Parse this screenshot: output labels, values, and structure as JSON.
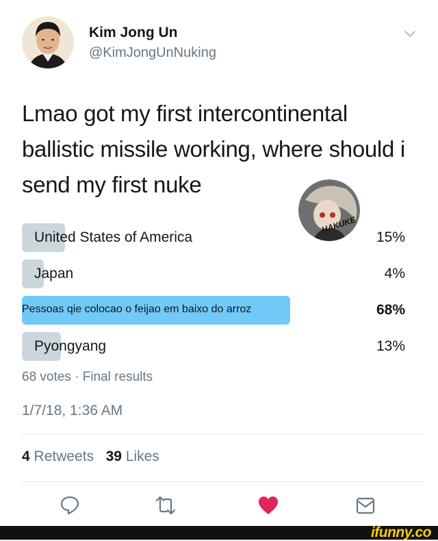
{
  "user": {
    "name": "Kim Jong Un",
    "handle": "@KimJongUnNuking"
  },
  "tweet": {
    "text": "Lmao got my first intercontinental ballistic missile working, where should i send my first nuke"
  },
  "poll": {
    "options": [
      {
        "label": "United States of America",
        "percent_label": "15%",
        "percent": 15
      },
      {
        "label": "Japan",
        "percent_label": "4%",
        "percent": 4
      },
      {
        "label": "Pessoas qie colocao o feijao em baixo do arroz",
        "percent_label": "68%",
        "percent": 68
      },
      {
        "label": "Pyongyang",
        "percent_label": "13%",
        "percent": 13
      }
    ],
    "summary": "68 votes · Final results"
  },
  "timestamp": "1/7/18, 1:36 AM",
  "stats": {
    "retweets_count": "4",
    "retweets_label": "Retweets",
    "likes_count": "39",
    "likes_label": "Likes"
  },
  "watermark": {
    "text": "HAKUKE"
  },
  "footer": {
    "brand": "ifunny.co"
  },
  "colors": {
    "winner_bar": "#71c9f8",
    "bar": "#ccd6dd",
    "like": "#e0245e",
    "muted": "#657786"
  },
  "icons": [
    "chevron-down-icon",
    "reply-icon",
    "retweet-icon",
    "heart-icon",
    "mail-icon"
  ]
}
